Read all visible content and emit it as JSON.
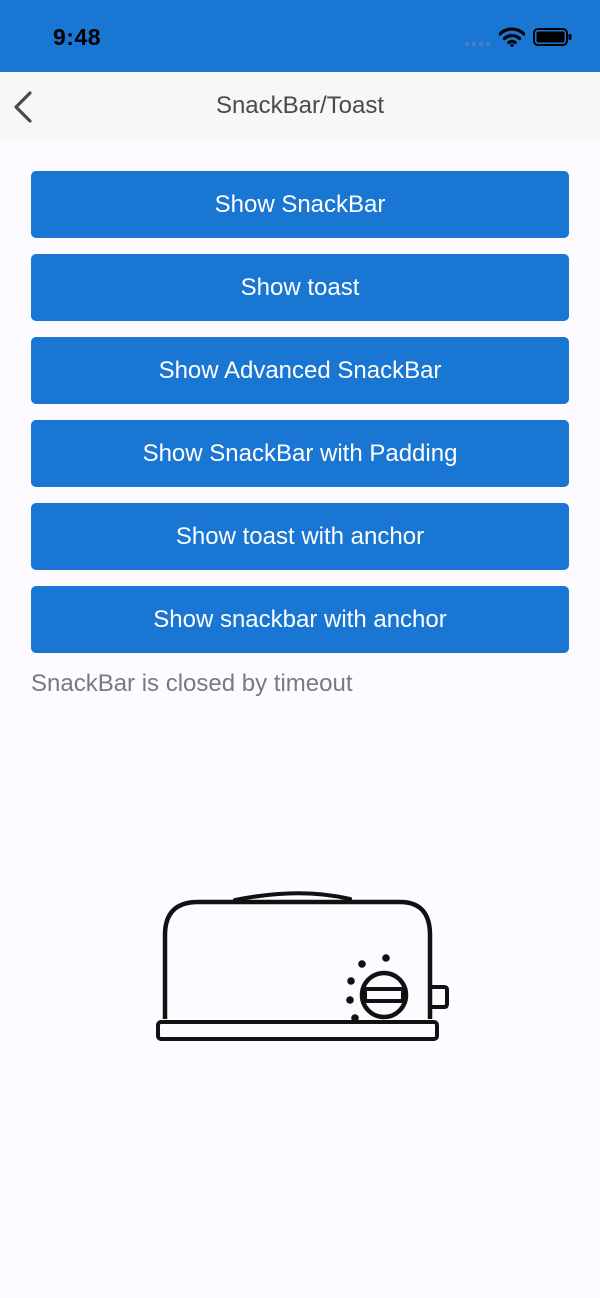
{
  "status_bar": {
    "time": "9:48",
    "background": "#1976d2",
    "icons": [
      "cellular-signal-icon",
      "wifi-icon",
      "battery-icon"
    ]
  },
  "nav": {
    "title": "SnackBar/Toast",
    "back_icon": "chevron-left-icon"
  },
  "buttons": [
    {
      "label": "Show SnackBar"
    },
    {
      "label": "Show toast"
    },
    {
      "label": "Show Advanced SnackBar"
    },
    {
      "label": "Show SnackBar with Padding"
    },
    {
      "label": "Show toast with anchor"
    },
    {
      "label": "Show snackbar with anchor"
    }
  ],
  "status_text": "SnackBar is closed by timeout",
  "illustration": "toaster-icon",
  "colors": {
    "accent": "#1976d2",
    "nav_background": "#f7f7f8",
    "page_background": "#fdfbff",
    "status_text": "#7a7a7a"
  }
}
